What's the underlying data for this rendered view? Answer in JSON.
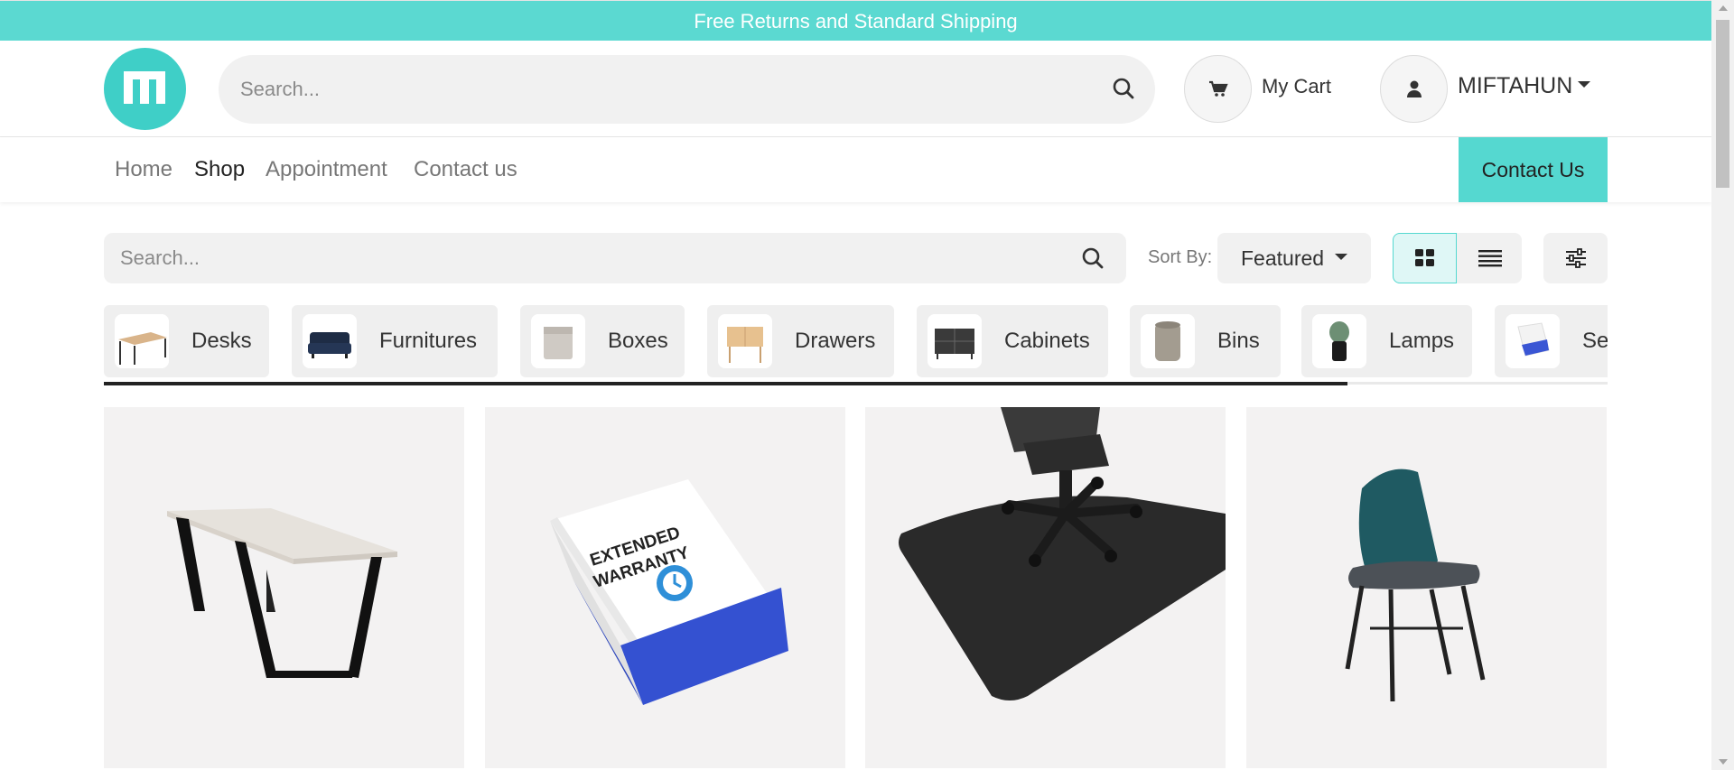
{
  "announcement": "Free Returns and Standard Shipping",
  "header": {
    "logo_icon": "brand-logo-m",
    "search_placeholder": "Search...",
    "cart_label": "My Cart",
    "user_name": "MIFTAHUN"
  },
  "nav": {
    "items": [
      {
        "label": "Home",
        "active": false
      },
      {
        "label": "Shop",
        "active": true
      },
      {
        "label": "Appointment",
        "active": false
      },
      {
        "label": "Contact us",
        "active": false
      }
    ],
    "cta_label": "Contact Us"
  },
  "toolbar": {
    "search_placeholder": "Search...",
    "sort_label": "Sort By:",
    "sort_value": "Featured",
    "view_modes": [
      "grid",
      "list"
    ],
    "active_view": "grid"
  },
  "categories": [
    {
      "label": "Desks"
    },
    {
      "label": "Furnitures"
    },
    {
      "label": "Boxes"
    },
    {
      "label": "Drawers"
    },
    {
      "label": "Cabinets"
    },
    {
      "label": "Bins"
    },
    {
      "label": "Lamps"
    },
    {
      "label": "Ser"
    }
  ],
  "products": [
    {
      "image": "white-desk-photo"
    },
    {
      "image": "extended-warranty-box-photo",
      "image_text": [
        "EXTENDED",
        "WARRANTY"
      ]
    },
    {
      "image": "office-chair-mat-photo"
    },
    {
      "image": "teal-chair-photo"
    }
  ],
  "colors": {
    "accent": "#55d8d0",
    "announce_bg": "#5bd9d1",
    "logo": "#3fcfc7"
  }
}
